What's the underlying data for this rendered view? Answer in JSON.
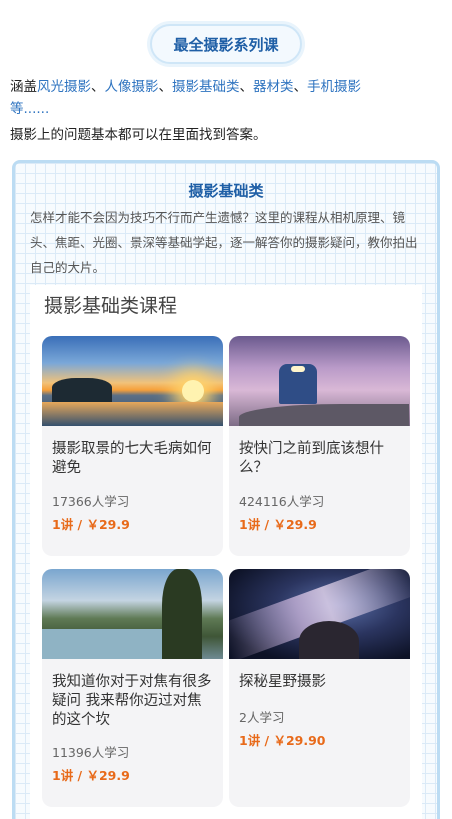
{
  "header": {
    "title": "最全摄影系列课"
  },
  "intro": {
    "prefix": "涵盖",
    "highlights": [
      "风光摄影",
      "人像摄影",
      "摄影基础类",
      "器材类",
      "手机摄影"
    ],
    "separator": "、",
    "suffix_line1_end": "等......",
    "line2": "摄影上的问题基本都可以在里面找到答案。"
  },
  "section": {
    "title": "摄影基础类",
    "description": "怎样才能不会因为技巧不行而产生遗憾？这里的课程从相机原理、镜头、焦距、光圈、景深等基础学起，逐一解答你的摄影疑问，教你拍出自己的大片。",
    "panel_heading": "摄影基础类课程"
  },
  "courses": [
    {
      "title": "摄影取景的七大毛病如何避免",
      "learners": "17366人学习",
      "price": "1讲 / ￥29.9",
      "thumbnail": "sunset-lake-photo"
    },
    {
      "title": "按快门之前到底该想什么？",
      "learners": "424116人学习",
      "price": "1讲 / ￥29.9",
      "thumbnail": "train-blossom-photo"
    },
    {
      "title": "我知道你对于对焦有很多疑问 我来帮你迈过对焦的这个坎",
      "learners": "11396人学习",
      "price": "1讲 / ￥29.9",
      "thumbnail": "forest-river-photo"
    },
    {
      "title": "探秘星野摄影",
      "learners": "2人学习",
      "price": "1讲 / ￥29.90",
      "thumbnail": "milky-way-photo"
    }
  ],
  "colors": {
    "accent": "#1f5fa6",
    "link": "#2f74c0",
    "price": "#e86a1a",
    "frame_border": "#bcdcf3"
  }
}
